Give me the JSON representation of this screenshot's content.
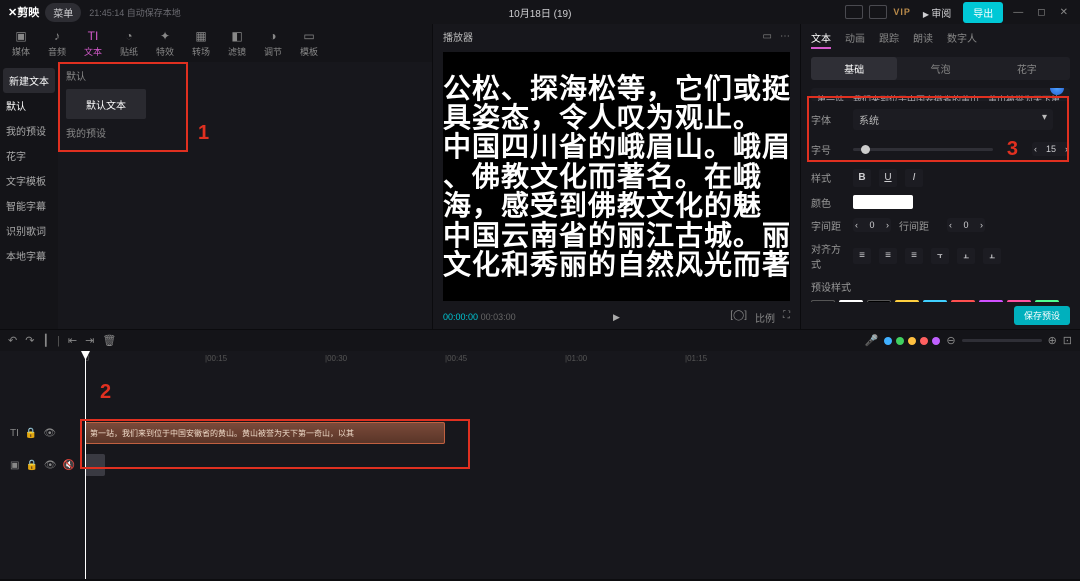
{
  "top": {
    "logo": "✕剪映",
    "menu": "菜单",
    "autosave": "21:45:14 自动保存本地",
    "title": "10月18日 (19)",
    "vip": "VIP",
    "review": "审阅",
    "export": "导出"
  },
  "tool_tabs": [
    {
      "icon": "▣",
      "label": "媒体"
    },
    {
      "icon": "♪",
      "label": "音频"
    },
    {
      "icon": "TI",
      "label": "文本"
    },
    {
      "icon": "◔",
      "label": "贴纸"
    },
    {
      "icon": "✦",
      "label": "特效"
    },
    {
      "icon": "▦",
      "label": "转场"
    },
    {
      "icon": "◧",
      "label": "滤镜"
    },
    {
      "icon": "◑",
      "label": "调节"
    },
    {
      "icon": "▭",
      "label": "模板"
    }
  ],
  "side_items": [
    "新建文本",
    "默认",
    "我的预设",
    "花字",
    "文字模板",
    "智能字幕",
    "识别歌词",
    "本地字幕"
  ],
  "left": {
    "sub": "默认",
    "chip": "默认文本",
    "preset_label": "我的预设"
  },
  "markers": {
    "m1": "1",
    "m2": "2",
    "m3": "3"
  },
  "player": {
    "title": "播放器",
    "lines": [
      "公松、探海松等，它们或挺",
      "具姿态，令人叹为观止。",
      "中国四川省的峨眉山。峨眉",
      "、佛教文化而著名。在峨",
      "海，感受到佛教文化的魅",
      "中国云南省的丽江古城。丽",
      "文化和秀丽的自然风光而著"
    ],
    "time": "00:00:00",
    "duration": "00:03:00"
  },
  "inspector": {
    "tabs": [
      "文本",
      "动画",
      "跟踪",
      "朗读",
      "数字人"
    ],
    "segs": [
      "基础",
      "气泡",
      "花字"
    ],
    "content": "第一站，我们来到位于中国安徽省的黄山。黄山被誉为天下第一奇山，以其奇松、怪石、云海、温泉四绝闻名于世。在黄山的巅上，你可以看到许多奇松，如迎客松、卧龙松、探海松等，它们或挺拔、或蜿立、或垂挂，各具姿态，令人叹为观止。\n第二站，我们来到位于中国四川省的峨眉山。峨眉山是中国著名的佛教圣地",
    "font_label": "字体",
    "font_value": "系统",
    "size_label": "字号",
    "size_value": "15",
    "style_label": "样式",
    "color_label": "颜色",
    "spacing_label": "字间距",
    "spacing_value": "0",
    "line_label": "行间距",
    "line_value": "0",
    "align_label": "对齐方式",
    "preset_label": "预设样式",
    "save": "保存预设",
    "preset_colors": [
      "#ffffff",
      "#000000",
      "#ffd040",
      "#40d0ff",
      "#ff5050",
      "#d050ff",
      "#ff50a0",
      "#50ff90"
    ]
  },
  "timeline": {
    "ticks": [
      "0",
      "|00:15",
      "|00:30",
      "|00:45",
      "|01:00",
      "|01:15"
    ],
    "clip_text": "第一站，我们来到位于中国安徽省的黄山。黄山被誉为天下第一奇山，以其",
    "gutter_t": "TI",
    "colored": [
      "#40b0ff",
      "#40d060",
      "#ffc040",
      "#ff6060",
      "#c060ff"
    ]
  }
}
